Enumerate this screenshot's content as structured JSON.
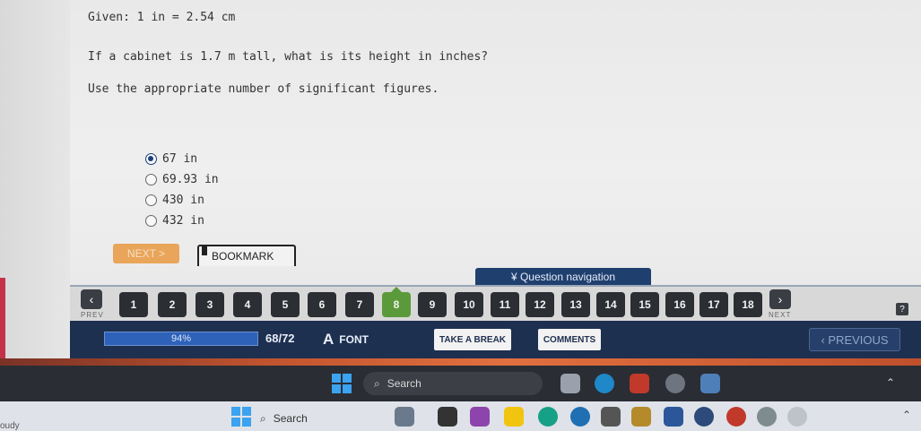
{
  "question": {
    "given": "Given: 1 in = 2.54 cm",
    "prompt": "If a cabinet is 1.7 m tall, what is its height in inches?",
    "instruction": "Use the appropriate number of significant figures."
  },
  "options": [
    {
      "label": "67 in",
      "selected": true
    },
    {
      "label": "69.93 in",
      "selected": false
    },
    {
      "label": "430 in",
      "selected": false
    },
    {
      "label": "432 in",
      "selected": false
    }
  ],
  "actions": {
    "next_label": "NEXT >",
    "bookmark_label": "BOOKMARK"
  },
  "question_nav": {
    "label": "¥ Question navigation",
    "prev_caption": "PREV",
    "next_caption": "NEXT",
    "numbers": [
      "1",
      "2",
      "3",
      "4",
      "5",
      "6",
      "7",
      "8",
      "9",
      "10",
      "11",
      "12",
      "13",
      "14",
      "15",
      "16",
      "17",
      "18"
    ],
    "current": "8",
    "help": "?"
  },
  "toolbar": {
    "progress_text": "94%",
    "progress_value": 0.94,
    "count": "68/72",
    "font_label": "FONT",
    "take_break": "TAKE A BREAK",
    "comments": "COMMENTS",
    "previous": "‹ PREVIOUS"
  },
  "taskbar": {
    "search_label": "Search",
    "search_label2": "Search",
    "weather": "oudy"
  },
  "colors": {
    "accent": "#1e3050",
    "current_question": "#5b9a3b",
    "next_button": "#e9a55a"
  }
}
